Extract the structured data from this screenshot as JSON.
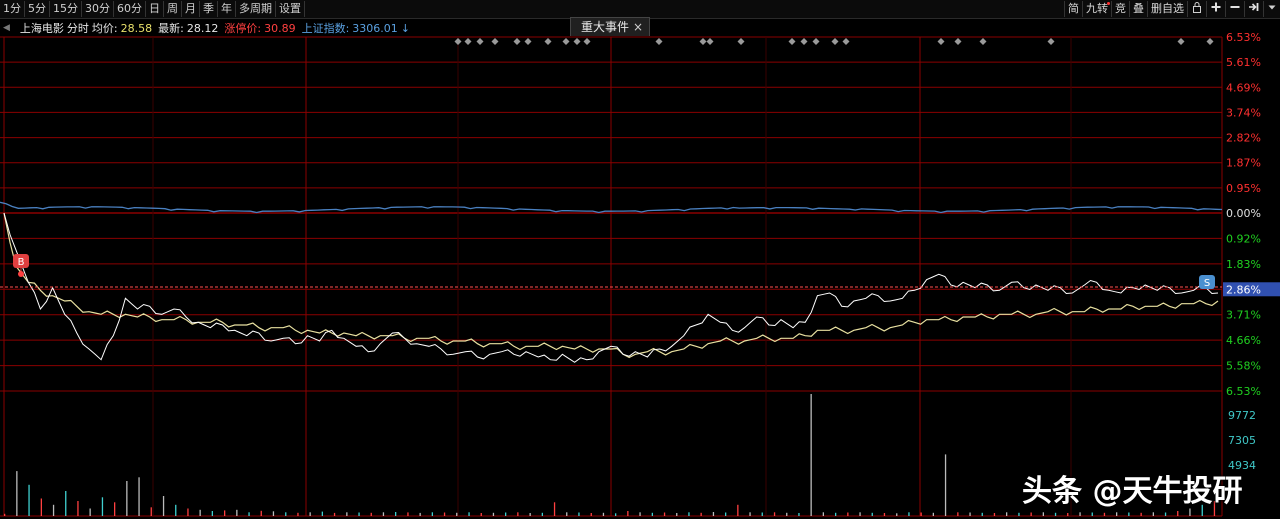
{
  "toolbar": {
    "periods": [
      "1分",
      "5分",
      "15分",
      "30分",
      "60分",
      "日",
      "周",
      "月",
      "季",
      "年",
      "多周期",
      "设置"
    ],
    "right_buttons": [
      "简",
      "九转",
      "竞",
      "叠",
      "删自选"
    ]
  },
  "infobar": {
    "stock": "上海电影",
    "mode": "分时",
    "avg_label": "均价:",
    "avg_value": "28.58",
    "last_label": "最新:",
    "last_value": "28.12",
    "limit_label": "涨停价:",
    "limit_value": "30.89",
    "index_label": "上证指数:",
    "index_value": "3306.01",
    "index_arrow": "↓"
  },
  "event_tab": {
    "label": "重大事件",
    "close": "×"
  },
  "markers": {
    "buy": "B",
    "sell": "S"
  },
  "colors": {
    "grid": "#8a0000",
    "price_line": "#ffffff",
    "avg_line": "#e8e0a0",
    "index_line": "#4a80c0",
    "axis_red": "#ff3030",
    "axis_green": "#20d020",
    "axis_cyan": "#40c8c8",
    "volume_up": "#ff4040",
    "volume_flat": "#bbbbbb",
    "volume_down": "#40d0d0"
  },
  "axis": {
    "upper_labels": [
      "6.53%",
      "5.61%",
      "4.69%",
      "3.74%",
      "2.82%",
      "1.87%",
      "0.95%",
      "0.00%"
    ],
    "lower_labels": [
      "0.92%",
      "1.83%",
      "2.86%",
      "3.71%",
      "4.66%",
      "5.58%",
      "6.53%"
    ],
    "current_label": "2.86%",
    "volume_labels": [
      "9772",
      "7305",
      "4934"
    ]
  },
  "watermark": "头条 @天牛投研",
  "chart_data": {
    "type": "line",
    "series": [
      {
        "values_pct": [
          0.0,
          -1.4,
          -2.6,
          -3.6,
          -2.8,
          -3.8,
          -4.5,
          -5.1,
          -5.5,
          -4.6,
          -3.2,
          -3.6,
          -3.5,
          -3.8,
          -3.6,
          -3.9,
          -4.1,
          -4.3,
          -4.2,
          -4.4,
          -4.6,
          -4.5,
          -4.8,
          -4.7,
          -4.9,
          -4.6,
          -4.8,
          -4.4,
          -4.7,
          -5.0,
          -5.2,
          -4.9,
          -4.5,
          -4.7,
          -4.9,
          -5.0,
          -5.1,
          -5.3,
          -5.2,
          -5.4,
          -5.3,
          -5.2,
          -5.3,
          -5.2,
          -5.4,
          -5.5,
          -5.3,
          -5.6,
          -5.5,
          -5.2,
          -5.0,
          -5.3,
          -5.2,
          -5.4,
          -5.1,
          -5.0,
          -4.6,
          -4.2,
          -3.8,
          -4.1,
          -4.4,
          -4.3,
          -3.9,
          -4.2,
          -4.0,
          -4.3,
          -4.1,
          -3.1,
          -3.0,
          -3.5,
          -3.3,
          -3.2,
          -3.1,
          -3.3,
          -3.2,
          -2.9,
          -2.5,
          -2.3,
          -2.7,
          -2.6,
          -2.8,
          -2.7,
          -2.9,
          -2.6,
          -2.8,
          -2.7,
          -2.9,
          -2.8,
          -3.0,
          -2.7,
          -2.6,
          -2.9,
          -3.0,
          -2.8,
          -2.7,
          -2.9,
          -2.8,
          -3.0,
          -2.9,
          -2.8,
          -3.0
        ]
      },
      {
        "values_pct": [
          0.0,
          -2.0,
          -2.6,
          -2.9,
          -3.1,
          -3.3,
          -3.5,
          -3.7,
          -3.8,
          -3.8,
          -3.8,
          -3.9,
          -3.9,
          -4.0,
          -4.0,
          -4.0,
          -4.1,
          -4.1,
          -4.1,
          -4.2,
          -4.2,
          -4.3,
          -4.3,
          -4.3,
          -4.4,
          -4.4,
          -4.5,
          -4.5,
          -4.5,
          -4.6,
          -4.6,
          -4.6,
          -4.6,
          -4.7,
          -4.7,
          -4.7,
          -4.8,
          -4.8,
          -4.8,
          -4.9,
          -4.9,
          -4.9,
          -5.0,
          -5.0,
          -5.0,
          -5.0,
          -5.0,
          -5.1,
          -5.1,
          -5.1,
          -5.1,
          -5.3,
          -5.3,
          -5.2,
          -5.2,
          -5.2,
          -5.1,
          -5.0,
          -4.9,
          -4.8,
          -4.8,
          -4.8,
          -4.7,
          -4.7,
          -4.7,
          -4.7,
          -4.6,
          -4.4,
          -4.4,
          -4.4,
          -4.4,
          -4.3,
          -4.3,
          -4.3,
          -4.2,
          -4.1,
          -4.0,
          -4.0,
          -4.0,
          -3.9,
          -3.9,
          -3.9,
          -3.8,
          -3.8,
          -3.8,
          -3.8,
          -3.7,
          -3.7,
          -3.7,
          -3.7,
          -3.6,
          -3.6,
          -3.6,
          -3.5,
          -3.5,
          -3.5,
          -3.5,
          -3.4,
          -3.4,
          -3.4,
          -3.3
        ]
      }
    ],
    "volume": [
      180,
      3600,
      2500,
      1400,
      900,
      2000,
      1200,
      600,
      1500,
      1100,
      2800,
      3100,
      700,
      1600,
      900,
      600,
      500,
      400,
      450,
      500,
      300,
      420,
      380,
      300,
      260,
      300,
      350,
      250,
      300,
      280,
      260,
      300,
      320,
      290,
      250,
      300,
      280,
      260,
      300,
      240,
      260,
      280,
      300,
      240,
      260,
      1100,
      300,
      280,
      240,
      260,
      220,
      400,
      300,
      260,
      280,
      240,
      300,
      260,
      320,
      280,
      900,
      300,
      280,
      300,
      260,
      240,
      9772,
      300,
      260,
      280,
      300,
      260,
      240,
      220,
      300,
      280,
      260,
      4934,
      300,
      280,
      260,
      240,
      300,
      260,
      280,
      300,
      260,
      240,
      300,
      280,
      260,
      300,
      280,
      260,
      300,
      280,
      400,
      600,
      900,
      1200
    ],
    "ylim_volume": [
      0,
      9772
    ]
  }
}
